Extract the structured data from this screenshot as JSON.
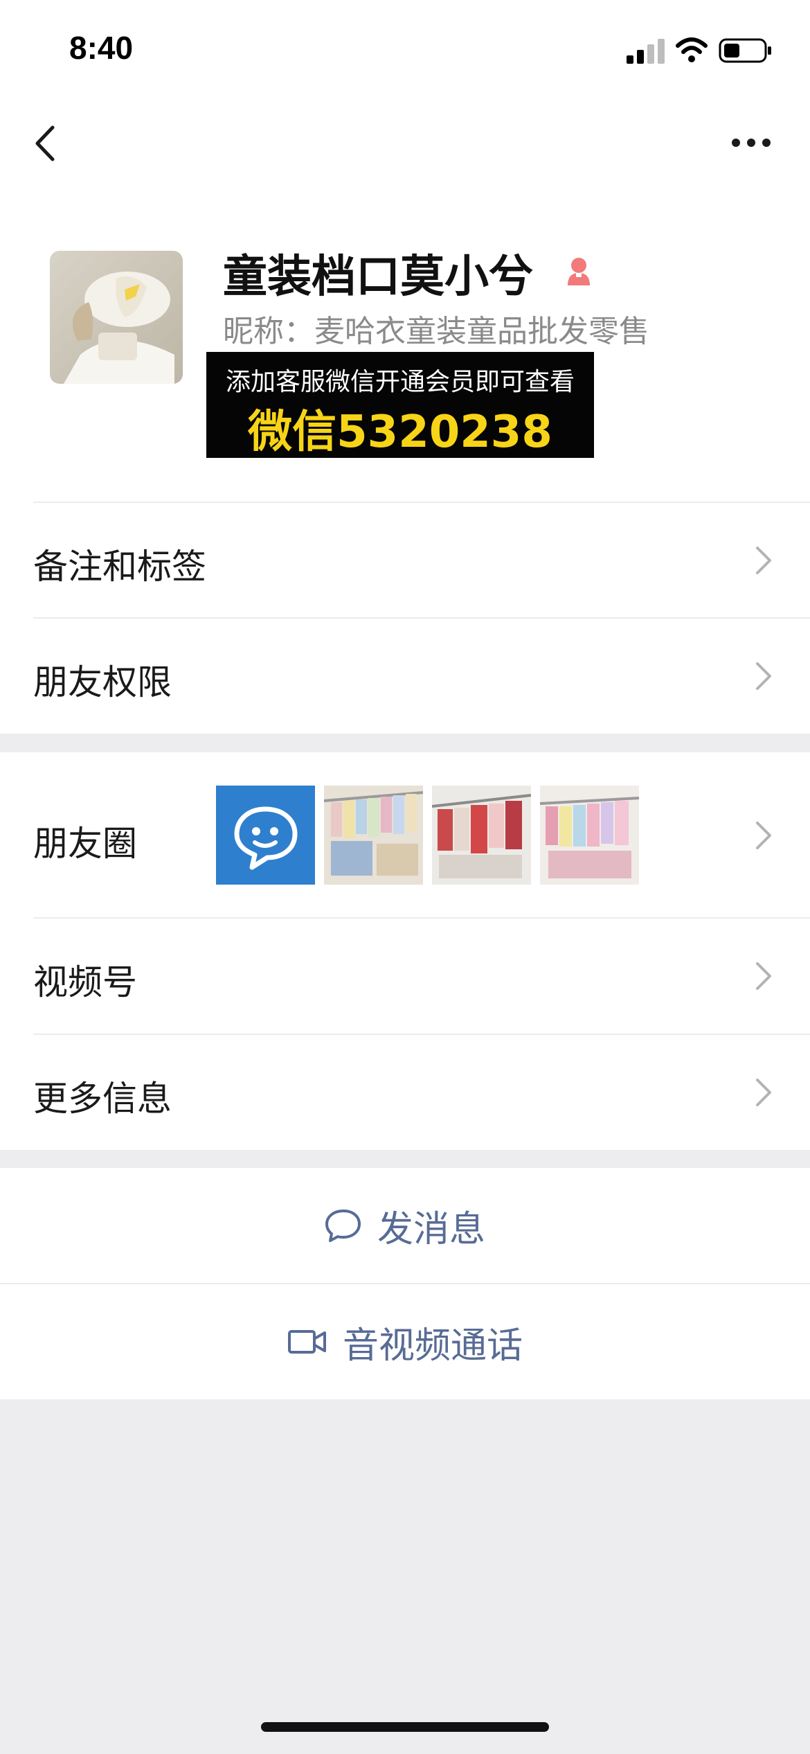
{
  "status_bar": {
    "time": "8:40"
  },
  "nav": {
    "back_icon": "chevron-left-icon",
    "more_icon": "ellipsis-icon"
  },
  "profile": {
    "name": "童装档口莫小兮",
    "gender_icon": "female-icon",
    "gender_color": "#f27a7a",
    "nickname": "昵称：麦哈衣童装童品批发零售",
    "promo_line1": "添加客服微信开通会员即可查看",
    "promo_line2": "微信5320238",
    "promo_text_color": "#f7d417"
  },
  "menu_group1": {
    "items": [
      {
        "label": "备注和标签"
      },
      {
        "label": "朋友权限"
      }
    ]
  },
  "menu_group2": {
    "moments_label": "朋友圈",
    "moments_icon": "chat-bubble-icon",
    "moments_icon_color": "#2f7fcf",
    "items": [
      {
        "label": "视频号"
      },
      {
        "label": "更多信息"
      }
    ]
  },
  "actions": {
    "message_label": "发消息",
    "message_icon": "speech-bubble-icon",
    "call_label": "音视频通话",
    "call_icon": "video-camera-icon",
    "accent_color": "#576b95"
  }
}
